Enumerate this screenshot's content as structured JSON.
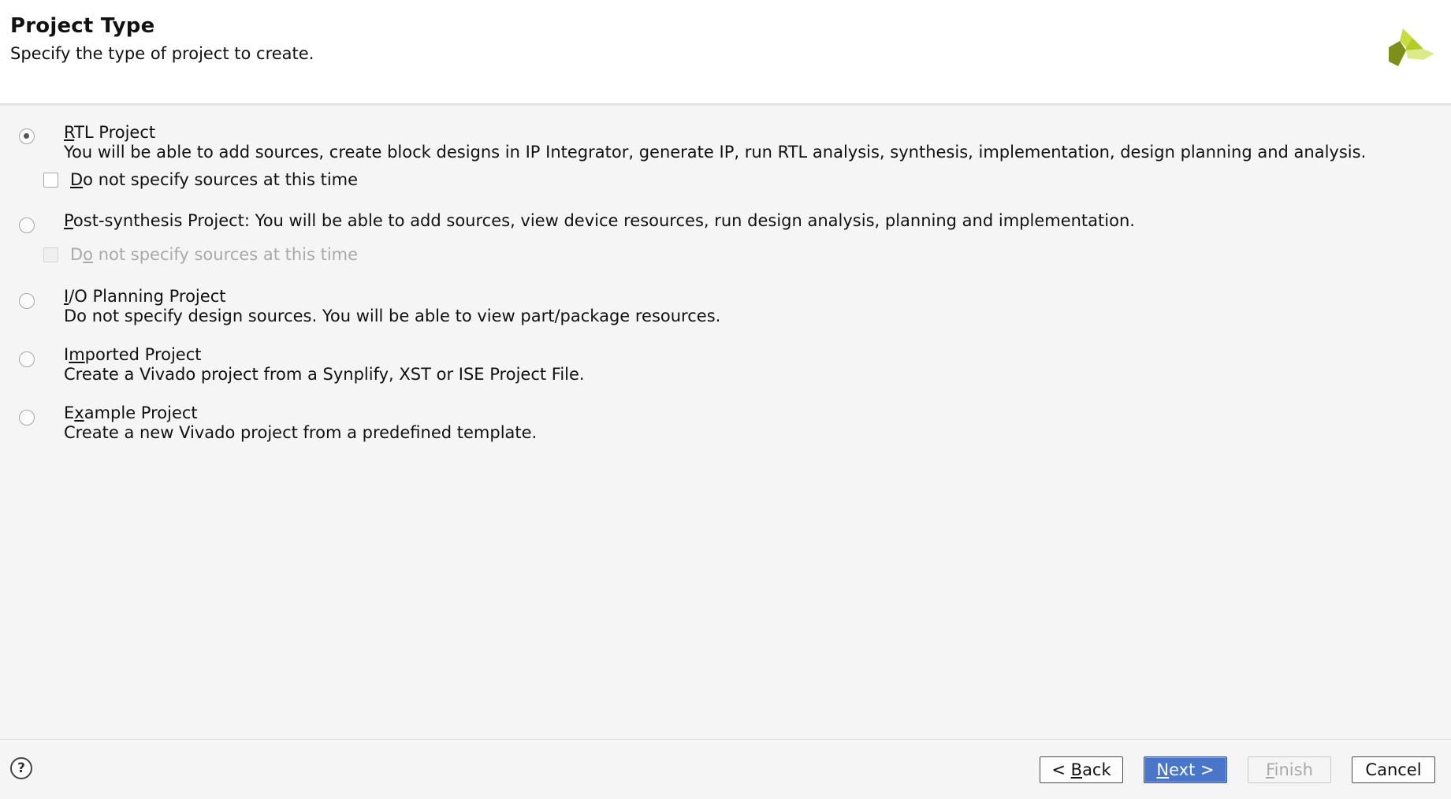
{
  "header": {
    "title": "Project Type",
    "subtitle": "Specify the type of project to create."
  },
  "options": [
    {
      "mnemonic": "R",
      "title_rest": "TL Project",
      "description": "You will be able to add sources, create block designs in IP Integrator, generate IP, run RTL analysis, synthesis, implementation, design planning and analysis.",
      "selected": true,
      "checkbox": {
        "mnemonic": "D",
        "label_rest": "o not specify sources at this time",
        "checked": false,
        "enabled": true
      }
    },
    {
      "mnemonic": "P",
      "title_rest": "ost-synthesis Project: You will be able to add sources, view device resources, run design analysis, planning and implementation.",
      "selected": false,
      "checkbox": {
        "label_pre": "D",
        "mnemonic": "o",
        "label_rest": " not specify sources at this time",
        "checked": false,
        "enabled": false
      }
    },
    {
      "mnemonic": "I",
      "title_rest": "/O Planning Project",
      "description": "Do not specify design sources. You will be able to view part/package resources.",
      "selected": false
    },
    {
      "label_pre": "I",
      "mnemonic": "m",
      "title_rest": "ported Project",
      "description": "Create a Vivado project from a Synplify, XST or ISE Project File.",
      "selected": false
    },
    {
      "label_pre": "E",
      "mnemonic": "x",
      "title_rest": "ample Project",
      "description": "Create a new Vivado project from a predefined template.",
      "selected": false
    }
  ],
  "footer": {
    "help_label": "?",
    "back": {
      "pre": "< ",
      "mnemonic": "B",
      "rest": "ack"
    },
    "next": {
      "mnemonic": "N",
      "rest": "ext >"
    },
    "finish": {
      "mnemonic": "F",
      "rest": "inish"
    },
    "cancel": {
      "label": "Cancel"
    }
  },
  "colors": {
    "primary_button": "#4a76c9",
    "logo_light": "#c8de3c",
    "logo_dark": "#7a8a18"
  }
}
